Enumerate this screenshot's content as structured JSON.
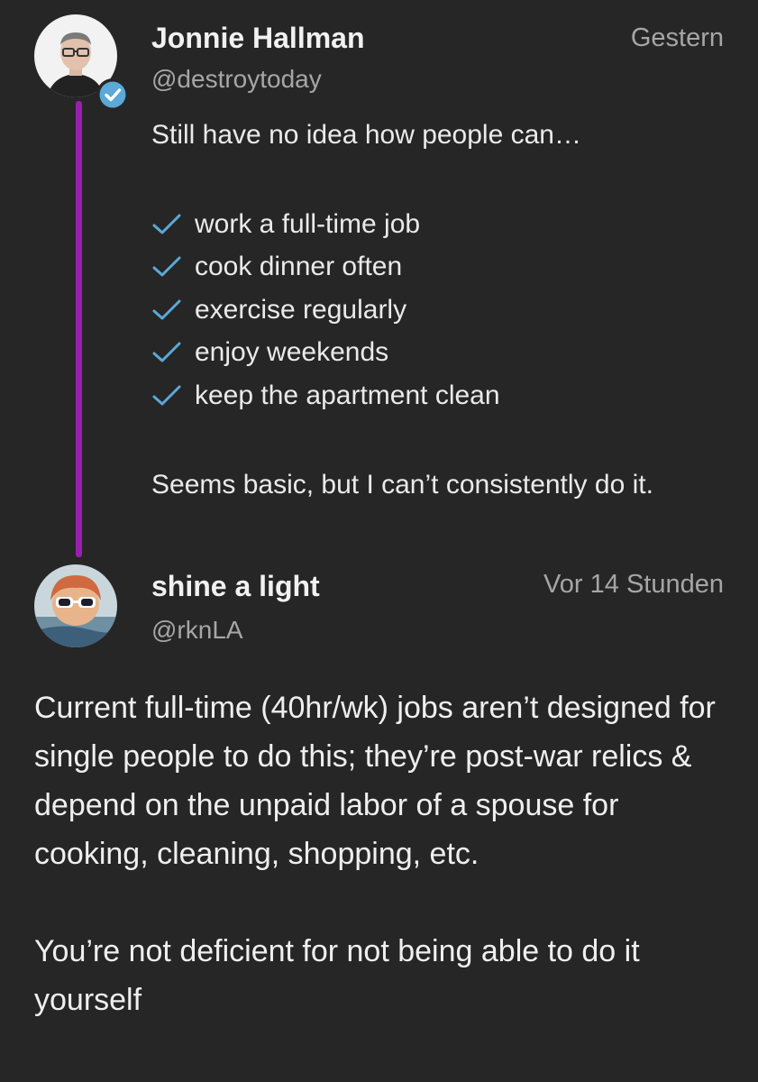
{
  "tweet1": {
    "author_name": "Jonnie Hallman",
    "handle": "@destroytoday",
    "time": "Gestern",
    "verified": true,
    "intro": "Still have no idea how people can…",
    "check_icon": "checkmark-icon",
    "check_color": "#5aa9d8",
    "checklist": [
      "work a full-time job",
      "cook dinner often",
      "exercise regularly",
      "enjoy weekends",
      "keep the apartment clean"
    ],
    "outro": "Seems basic, but I can’t consistently do it."
  },
  "thread_line_color": "#9a1fb0",
  "tweet2": {
    "author_name": "shine a light",
    "handle": "@rknLA",
    "time": "Vor 14 Stunden",
    "paragraphs": [
      "Current full-time (40hr/wk) jobs aren’t designed for single people to do this; they’re post-war relics & depend on the unpaid labor of a spouse for cooking, cleaning, shopping, etc.",
      "You’re not deficient for not being able to do it yourself"
    ]
  }
}
